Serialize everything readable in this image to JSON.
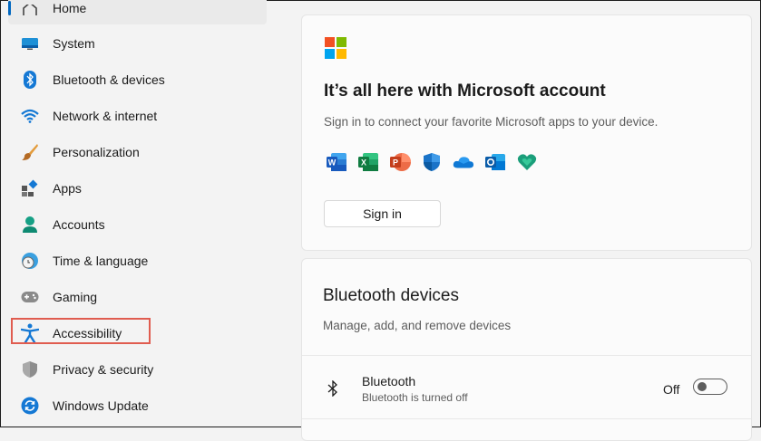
{
  "sidebar": {
    "items": [
      {
        "label": "Home",
        "icon": "home-icon"
      },
      {
        "label": "System",
        "icon": "monitor-icon"
      },
      {
        "label": "Bluetooth & devices",
        "icon": "bluetooth-icon"
      },
      {
        "label": "Network & internet",
        "icon": "wifi-icon"
      },
      {
        "label": "Personalization",
        "icon": "brush-icon"
      },
      {
        "label": "Apps",
        "icon": "apps-icon"
      },
      {
        "label": "Accounts",
        "icon": "person-icon"
      },
      {
        "label": "Time & language",
        "icon": "globe-clock-icon"
      },
      {
        "label": "Gaming",
        "icon": "gamepad-icon"
      },
      {
        "label": "Accessibility",
        "icon": "accessibility-icon"
      },
      {
        "label": "Privacy & security",
        "icon": "shield-icon"
      },
      {
        "label": "Windows Update",
        "icon": "update-icon"
      }
    ]
  },
  "account_card": {
    "title": "It’s all here with Microsoft account",
    "subtitle": "Sign in to connect your favorite Microsoft apps to your device.",
    "apps": [
      "word-icon",
      "excel-icon",
      "powerpoint-icon",
      "defender-icon",
      "onedrive-icon",
      "outlook-icon",
      "family-icon"
    ],
    "signin_label": "Sign in"
  },
  "bluetooth_card": {
    "title": "Bluetooth devices",
    "subtitle": "Manage, add, and remove devices",
    "row_name": "Bluetooth",
    "row_status": "Bluetooth is turned off",
    "toggle_state": "Off"
  },
  "colors": {
    "accent": "#0067c0",
    "highlight": "#e05c4f",
    "ms_red": "#f25022",
    "ms_green": "#7fba00",
    "ms_blue": "#00a4ef",
    "ms_yellow": "#ffb900"
  }
}
